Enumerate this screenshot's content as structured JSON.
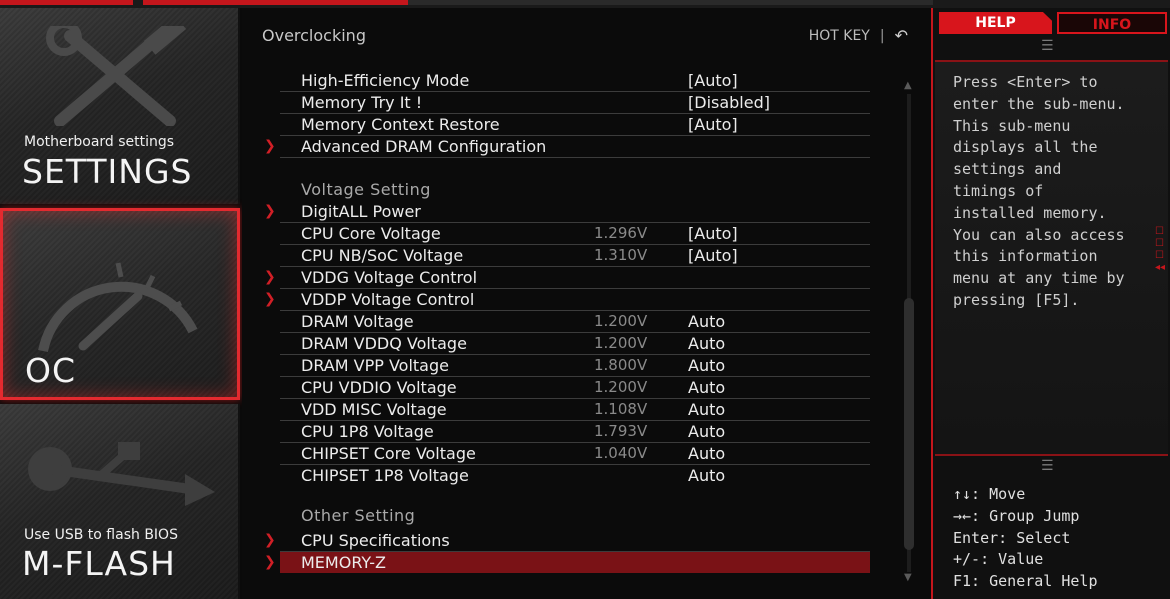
{
  "nav": {
    "settings": {
      "subtitle": "Motherboard settings",
      "title": "SETTINGS",
      "icon": "tools-icon"
    },
    "oc": {
      "title": "OC",
      "icon": "gauge-icon"
    },
    "mflash": {
      "subtitle": "Use USB to flash BIOS",
      "title": "M-FLASH",
      "icon": "usb-icon"
    }
  },
  "main": {
    "heading": "Overclocking",
    "hotkey_label": "HOT KEY",
    "hotkey_sep": "|",
    "back_glyph": "↶",
    "rows": [
      {
        "arrow": false,
        "label": "High-Efficiency Mode",
        "value": "",
        "option": "[Auto]"
      },
      {
        "arrow": false,
        "label": "Memory Try It !",
        "value": "",
        "option": "[Disabled]"
      },
      {
        "arrow": false,
        "label": "Memory Context Restore",
        "value": "",
        "option": "[Auto]"
      },
      {
        "arrow": true,
        "label": "Advanced DRAM Configuration",
        "value": "",
        "option": ""
      },
      {
        "arrow": true,
        "label": "DigitALL Power",
        "value": "",
        "option": ""
      },
      {
        "arrow": false,
        "label": "CPU Core Voltage",
        "value": "1.296V",
        "option": "[Auto]"
      },
      {
        "arrow": false,
        "label": "CPU NB/SoC Voltage",
        "value": "1.310V",
        "option": "[Auto]"
      },
      {
        "arrow": true,
        "label": "VDDG Voltage Control",
        "value": "",
        "option": ""
      },
      {
        "arrow": true,
        "label": "VDDP Voltage Control",
        "value": "",
        "option": ""
      },
      {
        "arrow": false,
        "label": "DRAM Voltage",
        "value": "1.200V",
        "option": "Auto"
      },
      {
        "arrow": false,
        "label": "DRAM VDDQ Voltage",
        "value": "1.200V",
        "option": "Auto"
      },
      {
        "arrow": false,
        "label": "DRAM VPP Voltage",
        "value": "1.800V",
        "option": "Auto"
      },
      {
        "arrow": false,
        "label": "CPU VDDIO Voltage",
        "value": "1.200V",
        "option": "Auto"
      },
      {
        "arrow": false,
        "label": "VDD MISC Voltage",
        "value": "1.108V",
        "option": "Auto"
      },
      {
        "arrow": false,
        "label": "CPU 1P8 Voltage",
        "value": "1.793V",
        "option": "Auto"
      },
      {
        "arrow": false,
        "label": "CHIPSET Core Voltage",
        "value": "1.040V",
        "option": "Auto"
      },
      {
        "arrow": false,
        "label": "CHIPSET 1P8 Voltage",
        "value": "",
        "option": "Auto"
      },
      {
        "arrow": true,
        "label": "CPU Specifications",
        "value": "",
        "option": ""
      },
      {
        "arrow": true,
        "label": "MEMORY-Z",
        "value": "",
        "option": "",
        "selected": true
      }
    ],
    "sections": {
      "voltage": "Voltage Setting",
      "other": "Other Setting"
    },
    "scroll": {
      "up": "▲",
      "down": "▼"
    }
  },
  "help": {
    "tab_help": "HELP",
    "tab_info": "INFO",
    "handle": "☰",
    "text": "Press <Enter> to\nenter the sub-menu.\nThis sub-menu\ndisplays all the\nsettings and\ntimings of\ninstalled memory.\nYou can also access\nthis information\nmenu at any time by\npressing [F5].",
    "keys": [
      "↑↓: Move",
      "→←: Group Jump",
      "Enter: Select",
      "+/-: Value",
      "F1: General Help"
    ]
  },
  "colors": {
    "accent": "#d8151c",
    "selected_row": "#7a1216",
    "background": "#0b0b0b"
  }
}
